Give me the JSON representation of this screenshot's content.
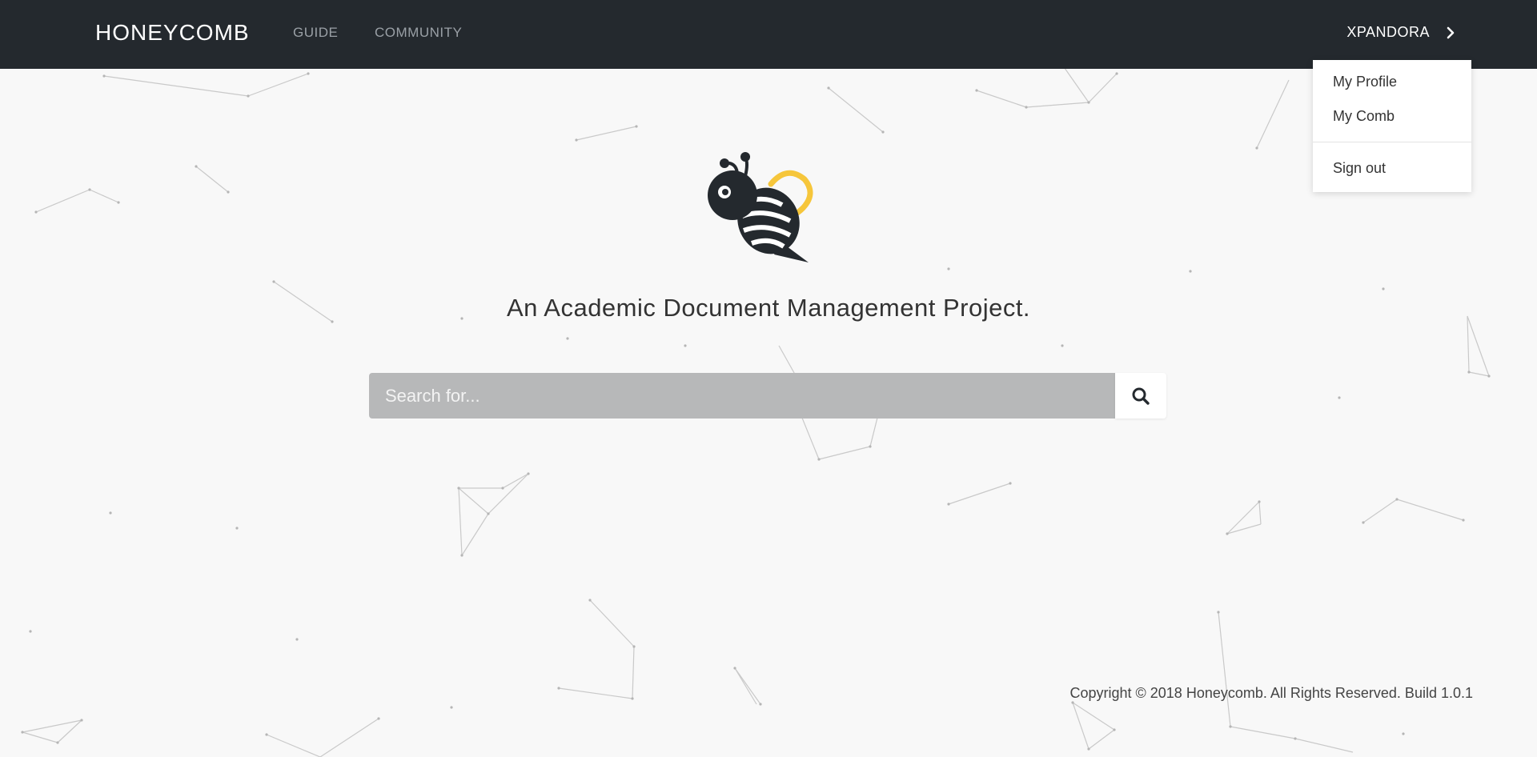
{
  "navbar": {
    "brand": "HONEYCOMB",
    "links": [
      "GUIDE",
      "COMMUNITY"
    ],
    "user": "XPANDORA",
    "user_icon": "chevron-right-icon"
  },
  "user_menu": {
    "items": [
      "My Profile",
      "My Comb"
    ],
    "sign_out": "Sign out"
  },
  "hero": {
    "logo": "bee-logo",
    "tagline": "An Academic Document Management Project."
  },
  "search": {
    "placeholder": "Search for...",
    "button_icon": "search-icon"
  },
  "footer": {
    "copyright": "Copyright © 2018 Honeycomb. All Rights Reserved. Build 1.0.1"
  },
  "colors": {
    "navbar_bg": "#24292e",
    "page_bg": "#f8f8f8",
    "search_bg": "#b7b8b9",
    "accent_yellow": "#f6c63b"
  }
}
